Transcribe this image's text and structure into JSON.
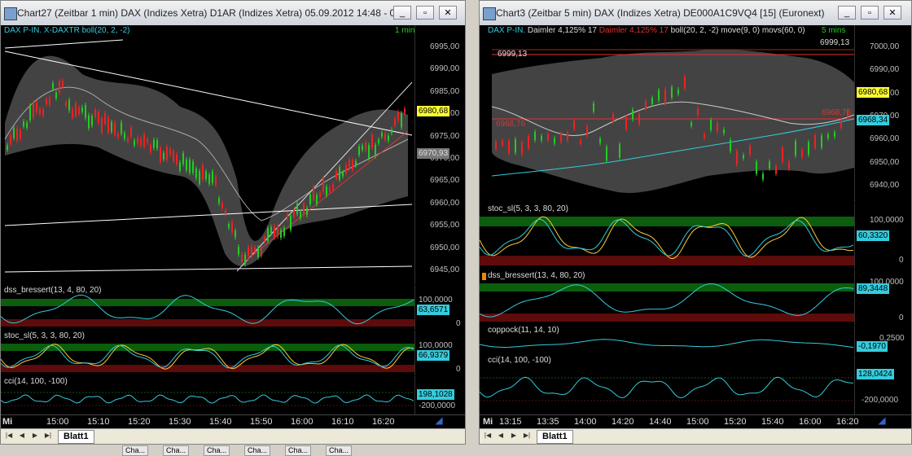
{
  "left": {
    "title": "Chart27 (Zeitbar 1 min)  DAX (Indizes Xetra) D1AR (Indizes Xetra) 05.09.2012 14:48 - 0...",
    "main_label": "DAX P-IN. X-DAXTR boll(20, 2, -2)",
    "interval": "1 min",
    "price_ticks": [
      "6995,00",
      "6990,00",
      "6985,00",
      "6980,00",
      "6975,00",
      "6970,00",
      "6965,00",
      "6960,00",
      "6955,00",
      "6950,00",
      "6945,00"
    ],
    "last_price": "6980,68",
    "marker_price": "6970,93",
    "dss_label": "dss_bressert(13, 4, 80, 20)",
    "dss_ticks": [
      "100,0000",
      "0"
    ],
    "dss_value": "63,6571",
    "stoc_label": "stoc_sl(5, 3, 3, 80, 20)",
    "stoc_ticks": [
      "100,0000",
      "0"
    ],
    "stoc_value": "66,9379",
    "cci_label": "cci(14, 100, -100)",
    "cci_ticks": [
      "198,1028",
      "-200,0000"
    ],
    "cci_value": "198,1028",
    "day": "Mi",
    "times": [
      "15:00",
      "15:10",
      "15:20",
      "15:30",
      "15:40",
      "15:50",
      "16:00",
      "16:10",
      "16:20"
    ],
    "tab": "Blatt1"
  },
  "right": {
    "title": "Chart3 (Zeitbar 5 min)  DAX (Indizes Xetra) DE000A1C9VQ4 [15] (Euronext)",
    "main_label_a": "DAX P-IN.",
    "main_label_b": "Daimler  4,125% 17",
    "main_label_c": "Daimler  4,125% 17",
    "main_label_d": "boll(20, 2, -2)",
    "main_label_e": "move(9, 0)",
    "main_label_f": "movs(60, 0)",
    "interval": "5 mins",
    "price_ticks": [
      "7000,00",
      "6990,00",
      "6980,00",
      "6970,00",
      "6960,00",
      "6950,00",
      "6940,00"
    ],
    "line_price": "6999,13",
    "line_price_right": "6999,13",
    "last_price": "6980,68",
    "ma_price": "6968,34",
    "red_label": "6968,76",
    "red_label_right": "6968,76",
    "stoc_label": "stoc_sl(5, 3, 3, 80, 20)",
    "stoc_ticks": [
      "100,0000",
      "0"
    ],
    "stoc_value": "60,3320",
    "dss_label": "dss_bressert(13, 4, 80, 20)",
    "dss_ticks": [
      "100,0000",
      "0"
    ],
    "dss_value": "89,3448",
    "coppock_label": "coppock(11, 14, 10)",
    "coppock_ticks": [
      "0,2500"
    ],
    "coppock_value": "-0,1970",
    "cci_label": "cci(14, 100, -100)",
    "cci_ticks": [
      "-200,0000"
    ],
    "cci_value": "128,0424",
    "day": "Mi",
    "times": [
      "13:15",
      "13:35",
      "14:00",
      "14:20",
      "14:40",
      "15:00",
      "15:20",
      "15:40",
      "16:00",
      "16:20"
    ],
    "tab": "Blatt1"
  },
  "taskbar": {
    "items": [
      "Cha...",
      "Cha...",
      "Cha...",
      "Cha...",
      "Cha...",
      "Cha..."
    ]
  },
  "colors": {
    "up": "#22cc22",
    "down": "#ee2222",
    "cyan": "#33ccdd",
    "band": "#555555",
    "green_zone": "#0b5e0b",
    "red_zone": "#5e0b0b"
  }
}
